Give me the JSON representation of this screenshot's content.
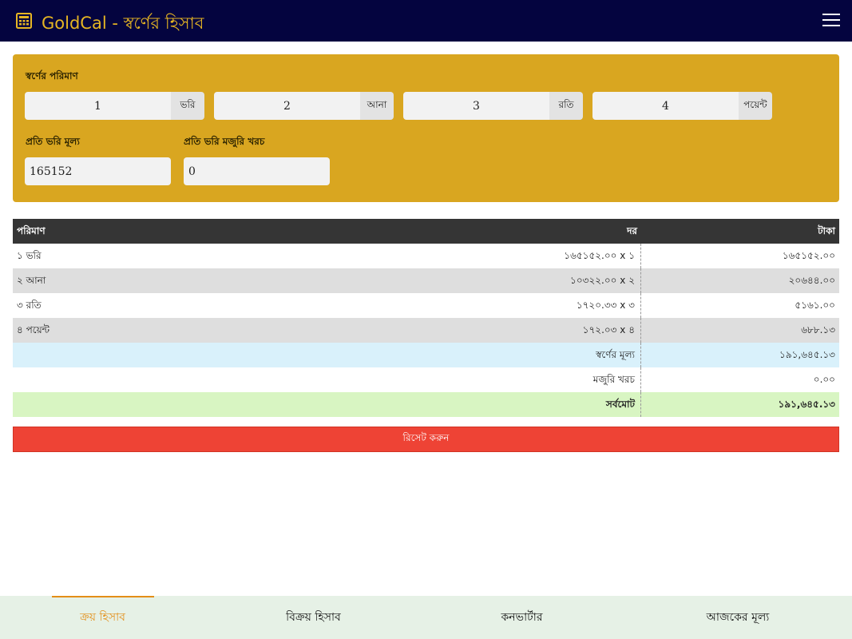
{
  "app": {
    "title": "GoldCal - স্বর্ণের হিসাব",
    "colors": {
      "header_bg": "#04043f",
      "title": "#e6b523",
      "panel": "#d9a620",
      "reset": "#ee4335",
      "active_tab": "#e38e17"
    }
  },
  "form": {
    "amount_label": "স্বর্ণের পরিমাণ",
    "units": [
      {
        "value": "1",
        "unit": "ভরি"
      },
      {
        "value": "2",
        "unit": "আনা"
      },
      {
        "value": "3",
        "unit": "রতি"
      },
      {
        "value": "4",
        "unit": "পয়েন্ট"
      }
    ],
    "price_label": "প্রতি ভরি মূল্য",
    "price_value": "165152",
    "making_label": "প্রতি ভরি মজুরি খরচ",
    "making_value": "0"
  },
  "table": {
    "headers": {
      "qty": "পরিমাণ",
      "rate": "দর",
      "amount": "টাকা"
    },
    "rows": [
      {
        "qty": "১ ভরি",
        "rate": "১৬৫১৫২.০০ x ১",
        "amount": "১৬৫১৫২.০০"
      },
      {
        "qty": "২ আনা",
        "rate": "১০৩২২.০০ x ২",
        "amount": "২০৬৪৪.০০"
      },
      {
        "qty": "৩ রতি",
        "rate": "১৭২০.৩৩ x ৩",
        "amount": "৫১৬১.০০"
      },
      {
        "qty": "৪ পয়েন্ট",
        "rate": "১৭২.০৩ x ৪",
        "amount": "৬৮৮.১৩"
      }
    ],
    "gold_value": {
      "label": "স্বর্ণের মূল্য",
      "amount": "১৯১,৬৪৫.১৩"
    },
    "making_cost": {
      "label": "মজুরি খরচ",
      "amount": "০.০০"
    },
    "grand_total": {
      "label": "সর্বমোট",
      "amount": "১৯১,৬৪৫.১৩"
    }
  },
  "reset_label": "রিসেট করুন",
  "tabs": [
    {
      "label": "ক্রয় হিসাব",
      "active": true
    },
    {
      "label": "বিক্রয় হিসাব",
      "active": false
    },
    {
      "label": "কনভার্টার",
      "active": false
    },
    {
      "label": "আজকের মূল্য",
      "active": false
    }
  ],
  "icons": {
    "app": "calculator-icon",
    "menu": "hamburger-menu-icon"
  }
}
